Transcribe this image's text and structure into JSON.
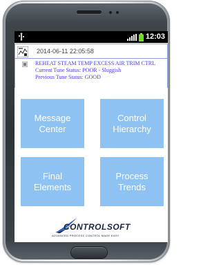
{
  "status_bar": {
    "time": "12:03",
    "usb_icon": "usb-icon",
    "signal_icon": "signal-icon",
    "battery_icon": "battery-icon"
  },
  "alert": {
    "icon": "tune-status-icon",
    "timestamp": "2014-06-11 22:05:58",
    "title": "REHEAT STEAM TEMP EXCESS AIR TRIM CTRL",
    "current_status": "Current Tune Status: POOR - Sluggish",
    "previous_status": "Previous Tune Status: GOOD",
    "text_color": "#4a3cf0"
  },
  "tiles": [
    {
      "line1": "Message",
      "line2": "Center"
    },
    {
      "line1": "Control",
      "line2": "Hierarchy"
    },
    {
      "line1": "Final",
      "line2": "Elements"
    },
    {
      "line1": "Process",
      "line2": "Trends"
    }
  ],
  "tile_color": "#8dc2f2",
  "logo": {
    "name": "CONTROLSOFT",
    "tagline": "ADVANCED PROCESS CONTROL MADE EASY"
  }
}
